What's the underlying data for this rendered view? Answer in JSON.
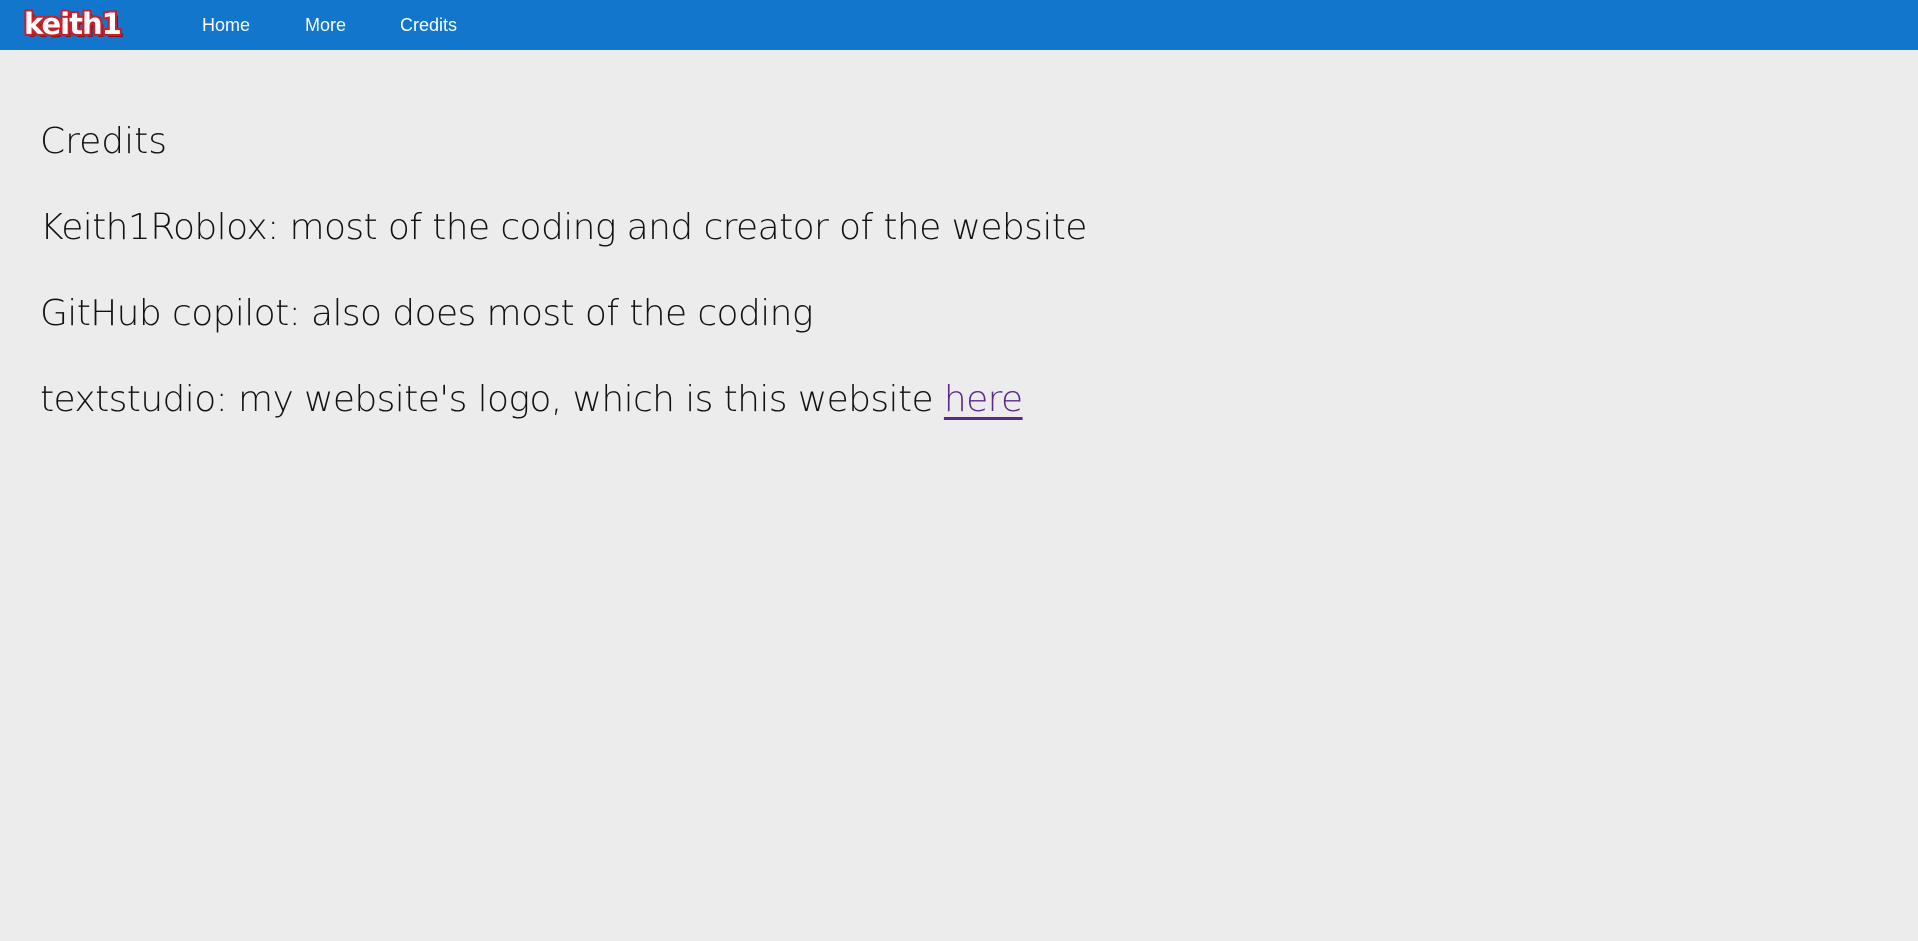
{
  "header": {
    "logo_text": "keith1",
    "background_color": "#1276cc",
    "nav": [
      {
        "label": "Home"
      },
      {
        "label": "More"
      },
      {
        "label": "Credits"
      }
    ]
  },
  "main": {
    "title": "Credits",
    "credits": [
      {
        "text": "Keith1Roblox: most of the coding and creator of the website"
      },
      {
        "text": "GitHub copilot: also does most of the coding"
      },
      {
        "text": "textstudio: my website's logo, which is this website ",
        "link_label": "here"
      }
    ],
    "link_color": "#5a2a8c",
    "background_color": "#ececec"
  }
}
